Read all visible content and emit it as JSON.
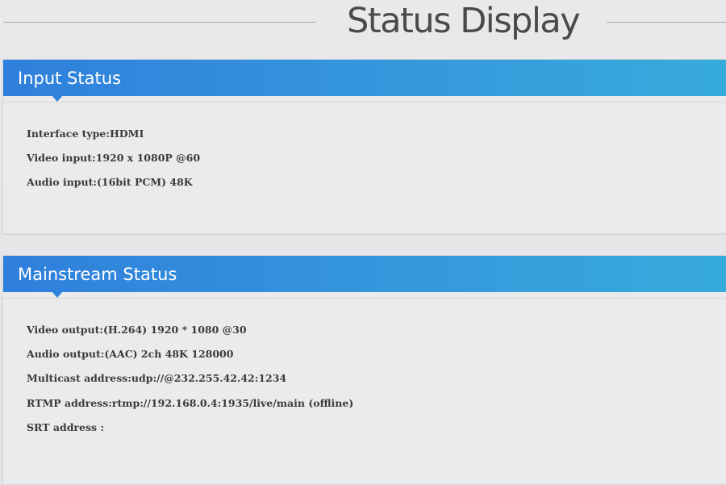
{
  "page": {
    "title": "Status Display"
  },
  "input_status": {
    "heading": "Input Status",
    "lines": [
      "Interface type:HDMI",
      "Video input:1920 x 1080P @60",
      "Audio input:(16bit PCM) 48K"
    ]
  },
  "mainstream_status": {
    "heading": "Mainstream Status",
    "lines": [
      "Video output:(H.264) 1920 * 1080 @30",
      "Audio output:(AAC) 2ch 48K 128000",
      "Multicast address:udp://@232.255.42.42:1234",
      "RTMP address:rtmp://192.168.0.4:1935/live/main (offline)",
      "SRT address :"
    ]
  },
  "colors": {
    "header_blue_start": "#2f7fdc",
    "header_blue_end": "#37abdc",
    "background": "#e9e9eb",
    "text": "#3a3a3a"
  }
}
